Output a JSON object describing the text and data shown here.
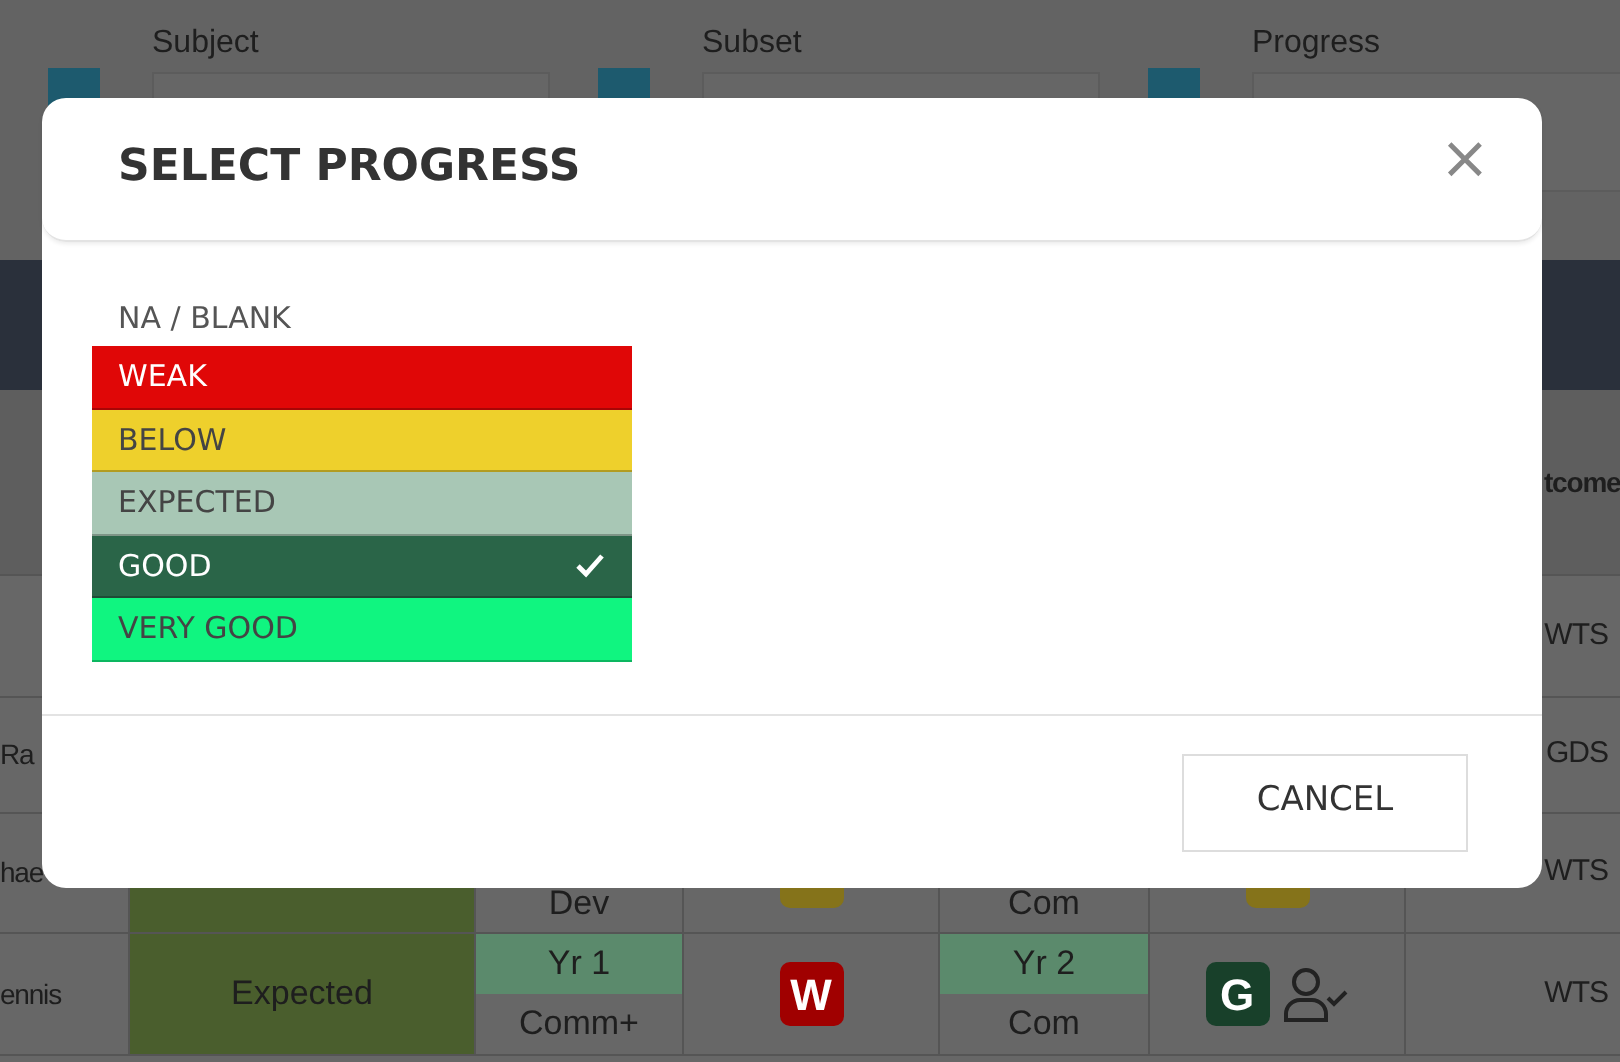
{
  "filters": [
    {
      "label": "Subject"
    },
    {
      "label": "Subset"
    },
    {
      "label": "Progress"
    }
  ],
  "table": {
    "header_last": "tcome",
    "rows": [
      {
        "outcome": "WTS"
      },
      {
        "name": "Ra",
        "outcome": "GDS"
      },
      {
        "name": "hae",
        "progress": {
          "color": "#4a5e2d"
        },
        "track1": {
          "subset": "Dev"
        },
        "grade1": {
          "color": "#85731a"
        },
        "track2": {
          "subset": "Com"
        },
        "grade2": {
          "color": "#85731a"
        },
        "outcome": "WTS"
      },
      {
        "name": "ennis",
        "progress": {
          "text": "Expected",
          "color": "#4a5e2d"
        },
        "track1": {
          "year": "Yr 1",
          "subset": "Comm+"
        },
        "grade1": {
          "letter": "W",
          "color": "#a00000"
        },
        "track2": {
          "year": "Yr 2",
          "subset": "Com"
        },
        "grade2": {
          "letter": "G",
          "color": "#18402a",
          "user_check": true
        },
        "outcome": "WTS"
      }
    ]
  },
  "modal": {
    "title": "SELECT PROGRESS",
    "close": "×",
    "options": [
      {
        "label": "NA / BLANK",
        "selected": false
      },
      {
        "label": "WEAK",
        "color": "#e00707",
        "selected": false
      },
      {
        "label": "BELOW",
        "color": "#eed02c",
        "selected": false
      },
      {
        "label": "EXPECTED",
        "color": "#a8c7b5",
        "selected": false
      },
      {
        "label": "GOOD",
        "color": "#2a6548",
        "selected": true
      },
      {
        "label": "VERY GOOD",
        "color": "#10f580",
        "selected": false
      }
    ],
    "cancel": "CANCEL"
  }
}
